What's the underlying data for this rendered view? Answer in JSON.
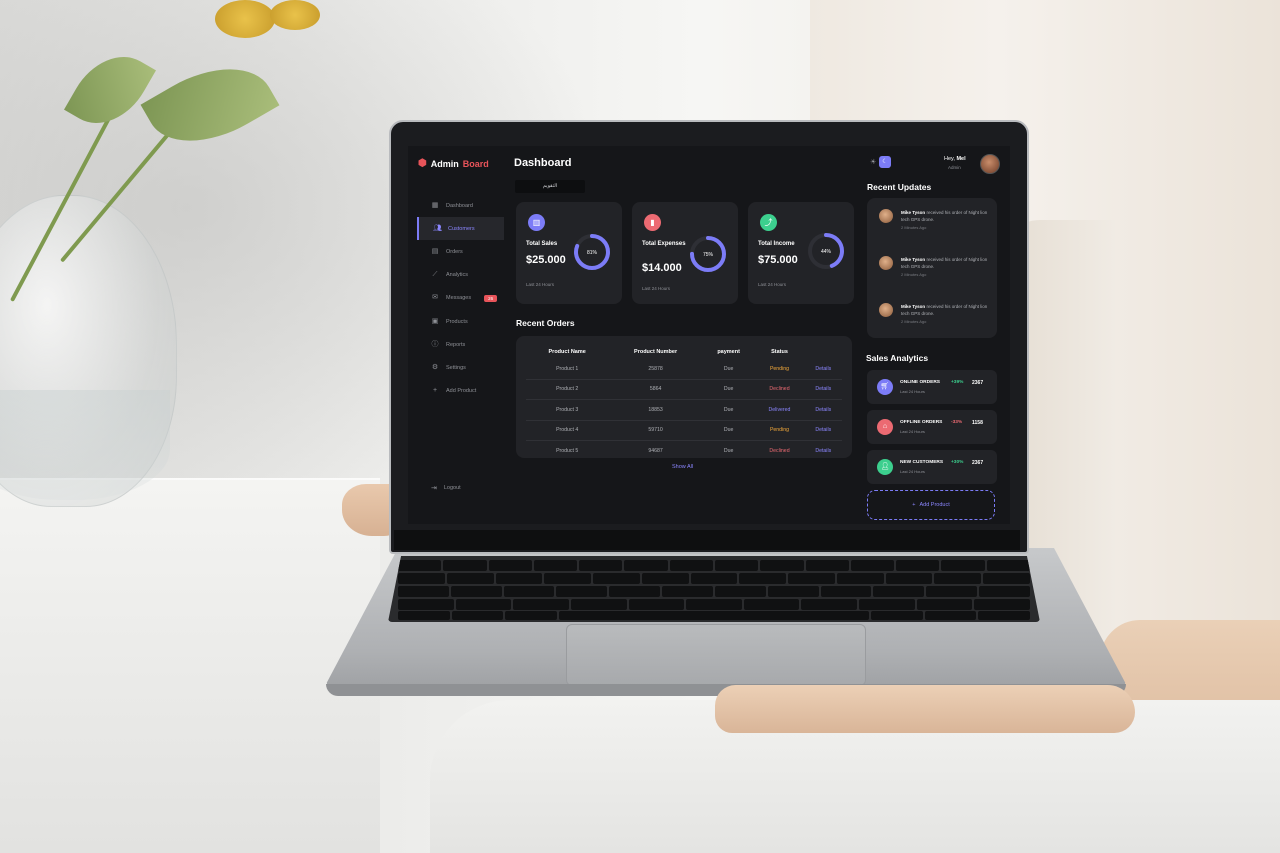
{
  "sidebar": {
    "brand": {
      "title": "Admin",
      "accent": "Board"
    },
    "items": [
      {
        "label": "Dashboard",
        "icon": "grid-icon",
        "active": false
      },
      {
        "label": "Customers",
        "icon": "users-icon",
        "active": true
      },
      {
        "label": "Orders",
        "icon": "clipboard-icon",
        "active": false
      },
      {
        "label": "Analytics",
        "icon": "chart-icon",
        "active": false
      },
      {
        "label": "Messages",
        "icon": "mail-icon",
        "active": false,
        "badge": "26"
      },
      {
        "label": "Products",
        "icon": "box-icon",
        "active": false
      },
      {
        "label": "Reports",
        "icon": "report-icon",
        "active": false
      },
      {
        "label": "Settings",
        "icon": "gear-icon",
        "active": false
      },
      {
        "label": "Add Product",
        "icon": "plus-icon",
        "active": false
      }
    ],
    "logout": "Logout"
  },
  "main": {
    "title": "Dashboard",
    "date": "التقويم",
    "cards": [
      {
        "label": "Total Sales",
        "value": "$25.000",
        "percent": "81%",
        "fraction": 0.81,
        "footer": "Last 24 Hours",
        "icon": "bar-chart-icon",
        "color": "#7c7cf7"
      },
      {
        "label": "Total Expenses",
        "value": "$14.000",
        "percent": "75%",
        "fraction": 0.75,
        "footer": "Last 24 Hours",
        "icon": "stats-icon",
        "color": "#ec6a72"
      },
      {
        "label": "Total Income",
        "value": "$75.000",
        "percent": "44%",
        "fraction": 0.44,
        "footer": "Last 24 Hours",
        "icon": "trend-icon",
        "color": "#3ccf8e"
      }
    ],
    "recent_orders": {
      "title": "Recent Orders",
      "columns": [
        "Product Name",
        "Product Number",
        "payment",
        "Status",
        ""
      ],
      "rows": [
        {
          "name": "Product 1",
          "number": "25878",
          "payment": "Due",
          "status": "Pending",
          "action": "Details"
        },
        {
          "name": "Product 2",
          "number": "5864",
          "payment": "Due",
          "status": "Declined",
          "action": "Details"
        },
        {
          "name": "Product 3",
          "number": "18853",
          "payment": "Due",
          "status": "Delivered",
          "action": "Details"
        },
        {
          "name": "Product 4",
          "number": "59710",
          "payment": "Due",
          "status": "Pending",
          "action": "Details"
        },
        {
          "name": "Product 5",
          "number": "94687",
          "payment": "Due",
          "status": "Declined",
          "action": "Details"
        }
      ],
      "show_all": "Show All"
    }
  },
  "right": {
    "greeting": "Hey,",
    "user": "Mel",
    "role": "Admin",
    "updates_title": "Recent Updates",
    "updates": [
      {
        "name": "Mike Tyson",
        "text": "received his order of Night lion tech GPS drone.",
        "time": "2 Minutes Ago"
      },
      {
        "name": "Mike Tyson",
        "text": "received his order of Night lion tech GPS drone.",
        "time": "2 Minutes Ago"
      },
      {
        "name": "Mike Tyson",
        "text": "received his order of Night lion tech GPS drone.",
        "time": "2 Minutes Ago"
      }
    ],
    "analytics_title": "Sales Analytics",
    "analytics": [
      {
        "name": "ONLINE ORDERS",
        "sub": "Last 24 Hours",
        "pct": "+39%",
        "num": "2367",
        "icon": "cart-icon",
        "color": "#7c7cf7",
        "pct_color": "#3ccf8e"
      },
      {
        "name": "OFFLINE ORDERS",
        "sub": "Last 24 Hours",
        "pct": "-33%",
        "num": "1158",
        "icon": "bag-icon",
        "color": "#ec6a72",
        "pct_color": "#ec6a72"
      },
      {
        "name": "NEW CUSTOMERS",
        "sub": "Last 24 Hours",
        "pct": "+30%",
        "num": "2367",
        "icon": "person-icon",
        "color": "#3ccf8e",
        "pct_color": "#3ccf8e"
      }
    ],
    "add_product": "Add Product"
  },
  "colors": {
    "pending": "#f2a93b",
    "declined": "#ec6a72",
    "delivered": "#8b86ff",
    "details": "#8b86ff"
  }
}
